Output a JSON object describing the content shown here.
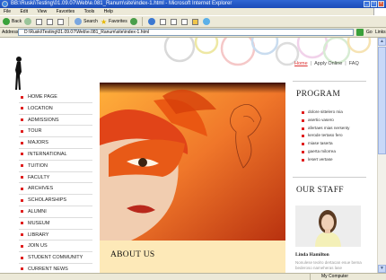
{
  "browser": {
    "window_title": "BB:\\Ruski\\Testing\\01.09.07\\Web\\e.081_Ranum\\site\\index-1.html - Microsoft Internet Explorer",
    "menu": [
      "File",
      "Edit",
      "View",
      "Favorites",
      "Tools",
      "Help"
    ],
    "toolbar": {
      "back": "Back",
      "search": "Search",
      "favorites": "Favorites"
    },
    "address_label": "Address",
    "address_value": "D:\\Ruski\\Testing\\01.09.07\\Web\\e.081_Ranum\\site\\index-1.html",
    "go_label": "Go",
    "links_label": "Links",
    "status_zone": "My Computer"
  },
  "site": {
    "top_links": [
      "Home",
      "Apply Online",
      "FAQ"
    ],
    "nav": [
      "HOME PAGE",
      "LOCATION",
      "ADMISSIONS",
      "TOUR",
      "MAJORS",
      "INTERNATIONAL",
      "TUITION",
      "FACULTY",
      "ARCHIVES",
      "SCHOLARSHIPS",
      "ALUMNI",
      "MUSEUM",
      "LIBRARY",
      "JOIN US",
      "STUDENT COMMUNITY",
      "CURRENT NEWS"
    ],
    "about_title": "ABOUT US",
    "program_title": "PROGRAM",
    "program_items": [
      "dolore sittelero mia",
      "asertio vasero",
      "afertaes mias nersenty",
      "kerode tertaso fero",
      "miase taserta",
      "gaerta milorrea",
      "lesert vertase"
    ],
    "staff_title": "OUR STAFF",
    "staff_name": "Linda Hamilton",
    "staff_text": "Nonulese teolro dertacan esue bema bederoso nameheras lase"
  },
  "colors": {
    "accent": "#e02020",
    "about_bg": "#fde9b8",
    "titlebar": "#1a4bb8"
  }
}
